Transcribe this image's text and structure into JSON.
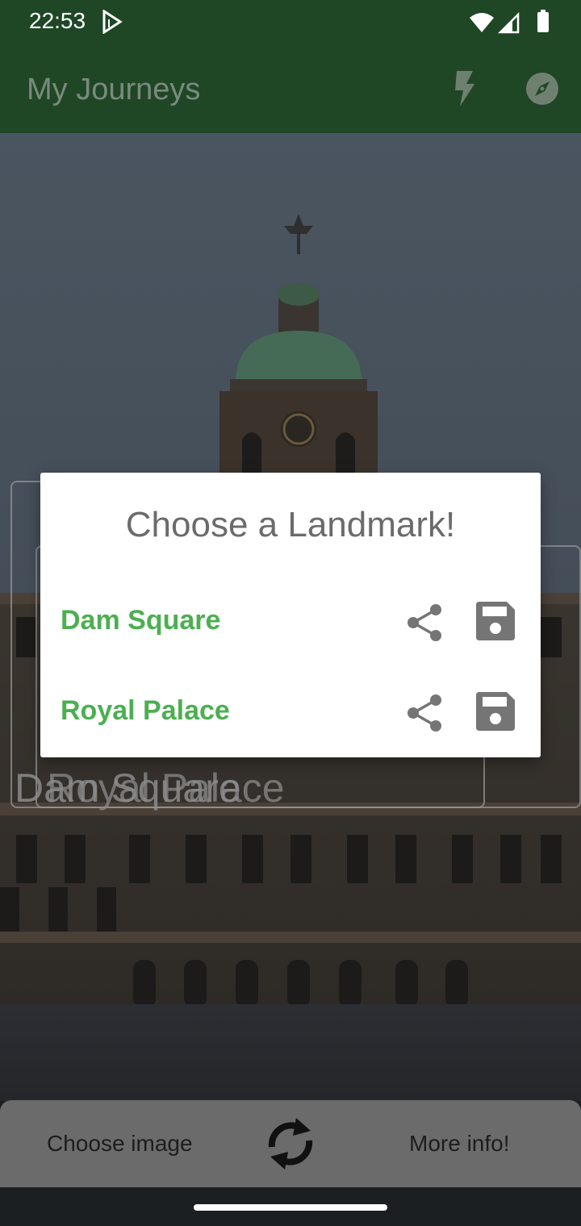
{
  "status": {
    "time": "22:53"
  },
  "app": {
    "title": "My Journeys"
  },
  "icons": {
    "play": "play-store-icon",
    "wifi": "wifi-icon",
    "signal": "signal-icon",
    "battery": "battery-icon",
    "flash": "flash-icon",
    "compass": "compass-icon",
    "share": "share-icon",
    "save": "save-icon",
    "refresh": "refresh-icon"
  },
  "overlay_labels": {
    "label_a": "Dam Square",
    "label_b": "Royal Palace"
  },
  "dialog": {
    "title": "Choose a Landmark!",
    "items": [
      {
        "label": "Dam Square"
      },
      {
        "label": "Royal Palace"
      }
    ]
  },
  "bottom": {
    "choose_image": "Choose image",
    "more_info": "More info!"
  },
  "colors": {
    "app_bar": "#1f4726",
    "accent_green": "#4caf50",
    "bottom_bar": "#6b6b6b"
  }
}
